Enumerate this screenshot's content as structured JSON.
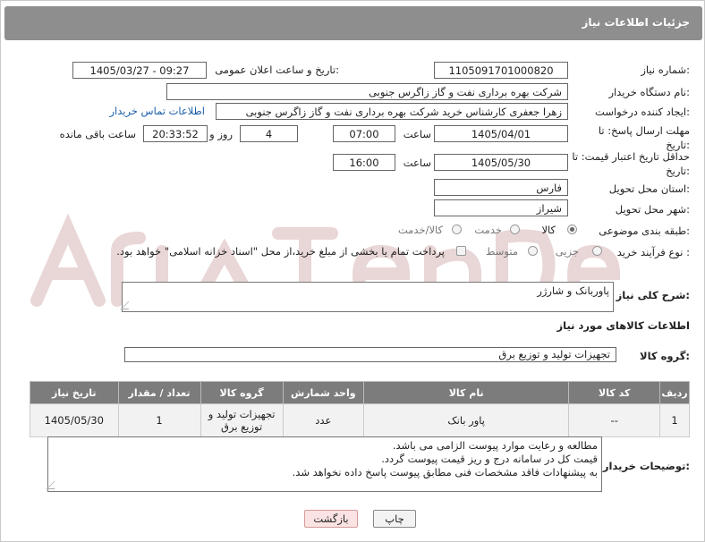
{
  "header": {
    "title": "جزئیات اطلاعات نیاز"
  },
  "fields": {
    "need_number_label": "شماره نیاز:",
    "need_number": "1105091701000820",
    "announce_label": "تاریخ و ساعت اعلان عمومی:",
    "announce_value": "1405/03/27 - 09:27",
    "buyer_org_label": "نام دستگاه خریدار:",
    "buyer_org": "شرکت بهره برداری نفت و گاز زاگرس جنوبی",
    "creator_label": "ایجاد کننده درخواست:",
    "creator": "زهرا جعفری کارشناس خرید شرکت بهره برداری نفت و گاز زاگرس جنوبی",
    "contact_link": "اطلاعات تماس خریدار",
    "reply_deadline_label": "مهلت ارسال پاسخ: تا تاریخ:",
    "reply_date": "1405/04/01",
    "time_label": "ساعت",
    "reply_time": "07:00",
    "days_value": "4",
    "days_label": "روز و",
    "remaining_time": "20:33:52",
    "remaining_label": "ساعت باقی مانده",
    "price_validity_label": "حداقل تاریخ اعتبار قیمت: تا تاریخ:",
    "price_date": "1405/05/30",
    "price_time": "16:00",
    "province_label": "استان محل تحویل:",
    "province": "فارس",
    "city_label": "شهر محل تحویل:",
    "city": "شیراز",
    "category_label": "طبقه بندی موضوعی:",
    "category_options": [
      "کالا",
      "خدمت",
      "کالا/خدمت"
    ],
    "process_label": "نوع فرآیند خرید :",
    "process_options": [
      "جزیی",
      "متوسط"
    ],
    "payment_note": "پرداخت تمام یا بخشی از مبلغ خرید،از محل \"اسناد خزانه اسلامی\" خواهد بود."
  },
  "description": {
    "label": "شرح کلی نیاز:",
    "value": "پاوربانک و شارژر"
  },
  "goods_section": {
    "title": "اطلاعات کالاهای مورد نیاز",
    "group_label": "گروه کالا:",
    "group_value": "تجهیزات تولید و توزیع برق"
  },
  "table": {
    "headers": [
      "ردیف",
      "کد کالا",
      "نام کالا",
      "واحد شمارش",
      "گروه کالا",
      "تعداد / مقدار",
      "تاریخ نیاز"
    ],
    "rows": [
      [
        "1",
        "--",
        "پاور بانک",
        "عدد",
        "تجهیزات تولید و توزیع برق",
        "1",
        "1405/05/30"
      ]
    ]
  },
  "buyer_notes": {
    "label": "توضیحات خریدار:",
    "lines": [
      "مطالعه و رعایت موارد پیوست الزامی می باشد.",
      "قیمت کل در سامانه درج و ریز قیمت پیوست گردد.",
      "به پیشنهادات فاقد مشخصات فنی مطابق پیوست پاسخ داده نخواهد شد."
    ]
  },
  "buttons": {
    "print": "چاپ",
    "back": "بازگشت"
  },
  "colors": {
    "header_bg": "#8e8e8e",
    "table_header_bg": "#7c7c7c",
    "link": "#1a5ea8",
    "back_button_bg": "#fbe3e3",
    "watermark": "#e7d2d2"
  }
}
